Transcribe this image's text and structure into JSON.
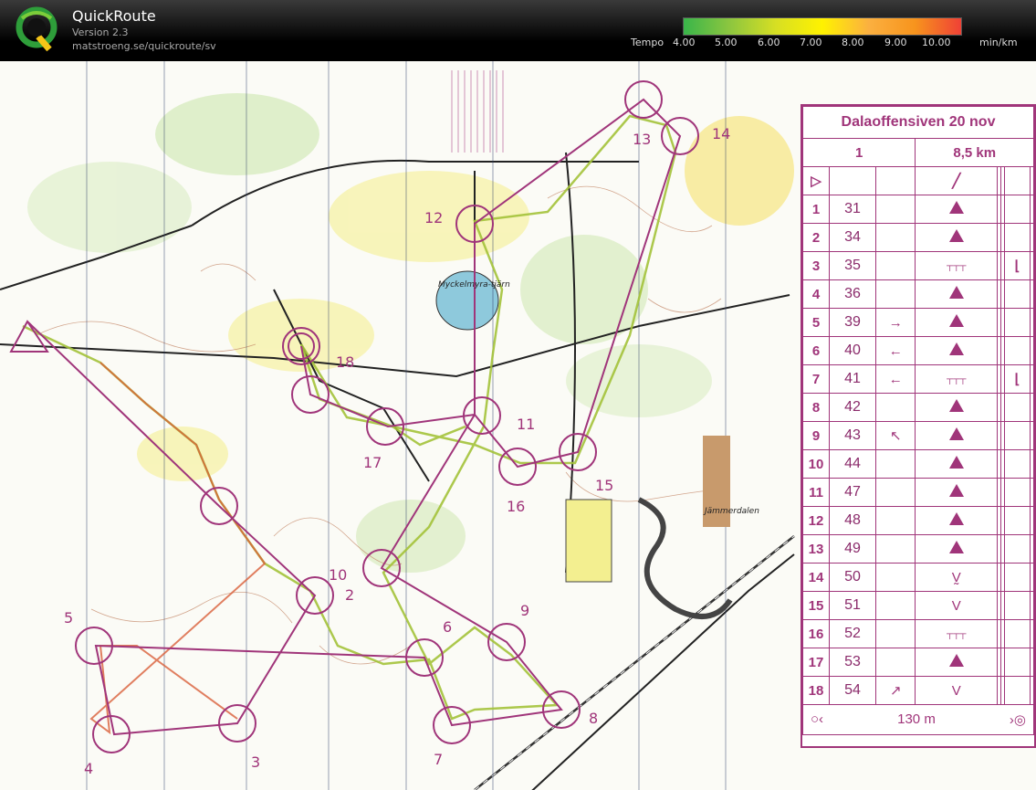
{
  "app": {
    "title": "QuickRoute",
    "version": "Version 2.3",
    "url": "matstroeng.se/quickroute/sv"
  },
  "legend": {
    "label": "Tempo",
    "ticks": [
      "4.00",
      "5.00",
      "6.00",
      "7.00",
      "8.00",
      "9.00",
      "10.00"
    ],
    "unit": "min/km",
    "colors": [
      "#39b54a",
      "#8dc63f",
      "#d7df23",
      "#fff200",
      "#fbb040",
      "#f7941d",
      "#ef4136"
    ]
  },
  "map": {
    "place_names": [
      "Myckelmyra-tjärn",
      "Jämmerdalen"
    ],
    "control_labels": [
      "2",
      "3",
      "4",
      "5",
      "6",
      "7",
      "8",
      "9",
      "10",
      "11",
      "12",
      "13",
      "14",
      "15",
      "16",
      "17",
      "18"
    ]
  },
  "description_sheet": {
    "event": "Dalaoffensiven 20 nov",
    "class": "1",
    "distance": "8,5 km",
    "controls": [
      {
        "num": "1",
        "code": "31"
      },
      {
        "num": "2",
        "code": "34"
      },
      {
        "num": "3",
        "code": "35"
      },
      {
        "num": "4",
        "code": "36"
      },
      {
        "num": "5",
        "code": "39"
      },
      {
        "num": "6",
        "code": "40"
      },
      {
        "num": "7",
        "code": "41"
      },
      {
        "num": "8",
        "code": "42"
      },
      {
        "num": "9",
        "code": "43"
      },
      {
        "num": "10",
        "code": "44"
      },
      {
        "num": "11",
        "code": "47"
      },
      {
        "num": "12",
        "code": "48"
      },
      {
        "num": "13",
        "code": "49"
      },
      {
        "num": "14",
        "code": "50"
      },
      {
        "num": "15",
        "code": "51"
      },
      {
        "num": "16",
        "code": "52"
      },
      {
        "num": "17",
        "code": "53"
      },
      {
        "num": "18",
        "code": "54"
      }
    ],
    "finish_distance": "130 m"
  }
}
